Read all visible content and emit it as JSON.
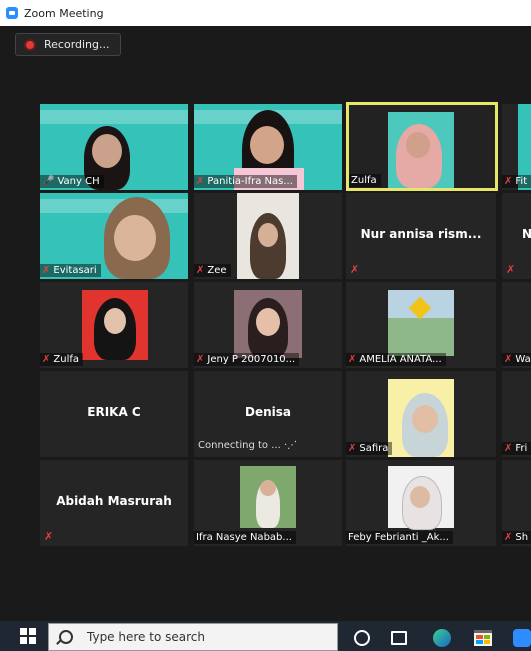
{
  "window": {
    "title": "Zoom Meeting"
  },
  "recording": {
    "label": "Recording..."
  },
  "tiles": [
    {
      "name": "Vany CH",
      "muted": false
    },
    {
      "name": "Panitia-Ifra Nas...",
      "muted": true
    },
    {
      "name": "Zulfa",
      "muted": false,
      "active": true
    },
    {
      "name": "Fit",
      "muted": true
    },
    {
      "name": "Evitasari",
      "muted": true
    },
    {
      "name": "Zee",
      "muted": true
    },
    {
      "name": "Nur annisa rism...",
      "muted": true
    },
    {
      "name": "N",
      "muted": true
    },
    {
      "name": "Zulfa",
      "muted": true
    },
    {
      "name": "Jeny P 2007010...",
      "muted": true
    },
    {
      "name": "AMELIA ANATA...",
      "muted": true
    },
    {
      "name": "Wa",
      "muted": true
    },
    {
      "name": "ERIKA C",
      "muted": false
    },
    {
      "name": "Denisa",
      "status": "Connecting to ...",
      "muted": false
    },
    {
      "name": "Safira",
      "muted": true
    },
    {
      "name": "Fri",
      "muted": true
    },
    {
      "name": "Abidah Masrurah",
      "muted": true
    },
    {
      "name": "Ifra Nasye Nabab...",
      "muted": false
    },
    {
      "name": "Feby Febrianti _Ak...",
      "muted": false
    },
    {
      "name": "Sh",
      "muted": true
    }
  ],
  "taskbar": {
    "search_placeholder": "Type here to search",
    "icons": [
      "windows-start-icon",
      "search-icon",
      "cortana-icon",
      "task-view-icon",
      "edge-icon",
      "store-icon",
      "zoom-icon"
    ]
  }
}
